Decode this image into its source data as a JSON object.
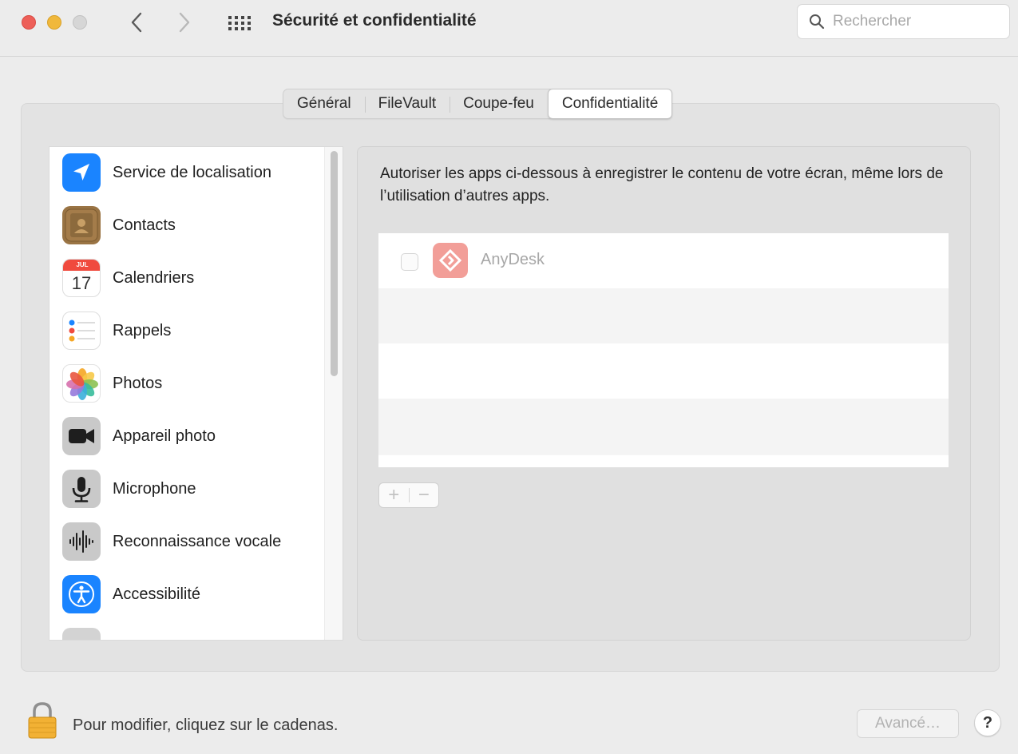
{
  "window": {
    "title": "Sécurité et confidentialité"
  },
  "search": {
    "placeholder": "Rechercher"
  },
  "tabs": [
    {
      "label": "Général"
    },
    {
      "label": "FileVault"
    },
    {
      "label": "Coupe-feu"
    },
    {
      "label": "Confidentialité",
      "active": true
    }
  ],
  "sidebar": {
    "items": [
      {
        "label": "Service de localisation",
        "icon": "location-arrow-icon"
      },
      {
        "label": "Contacts",
        "icon": "contacts-book-icon"
      },
      {
        "label": "Calendriers",
        "icon": "calendar-icon",
        "month": "JUL",
        "day": "17"
      },
      {
        "label": "Rappels",
        "icon": "reminders-icon"
      },
      {
        "label": "Photos",
        "icon": "photos-flower-icon"
      },
      {
        "label": "Appareil photo",
        "icon": "camera-icon"
      },
      {
        "label": "Microphone",
        "icon": "microphone-icon"
      },
      {
        "label": "Reconnaissance vocale",
        "icon": "speech-waveform-icon"
      },
      {
        "label": "Accessibilité",
        "icon": "accessibility-icon"
      }
    ]
  },
  "main": {
    "description": "Autoriser les apps ci-dessous à enregistrer le contenu de votre écran, même lors de l’utilisation d’autres apps.",
    "apps": [
      {
        "name": "AnyDesk",
        "checked": false,
        "icon": "anydesk-icon"
      }
    ],
    "add_label": "+",
    "remove_label": "−"
  },
  "footer": {
    "lock_text": "Pour modifier, cliquez sur le cadenas.",
    "advanced_label": "Avancé…",
    "help_label": "?"
  },
  "colors": {
    "traffic_red": "#ed5f58",
    "traffic_yellow": "#f0b83c",
    "accent_blue": "#1a84ff",
    "anydesk_red": "#f29e98"
  }
}
